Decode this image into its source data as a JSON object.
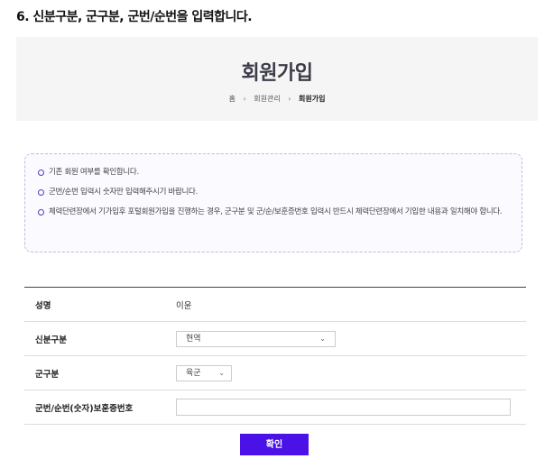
{
  "step_title": "6. 신분구분, 군구분, 군번/순번을 입력합니다.",
  "hero": {
    "title": "회원가입",
    "breadcrumb": {
      "home": "홈",
      "sep": "›",
      "section": "회원관리",
      "current": "회원가입"
    }
  },
  "notice": {
    "items": [
      "기존 회원 여부를 확인합니다.",
      "군번/순번 입력시 숫자만 입력해주시기 바랍니다.",
      "체력단련장에서 기가입후 포털회원가입을 진행하는 경우, 군구분 및 군/순/보훈증번호 입력시 반드시 체력단련장에서 기입한 내용과 일치해야 합니다."
    ]
  },
  "form": {
    "name_label": "성명",
    "name_value": "이윤",
    "status_label": "신분구분",
    "status_value": "현역",
    "branch_label": "군구분",
    "branch_value": "육군",
    "id_label": "군번/순번(숫자)보훈증번호",
    "id_value": ""
  },
  "confirm_label": "확인",
  "colors": {
    "accent": "#4a12e6",
    "bullet": "#4a3fbf",
    "hero_bg": "#f5f5f5"
  }
}
